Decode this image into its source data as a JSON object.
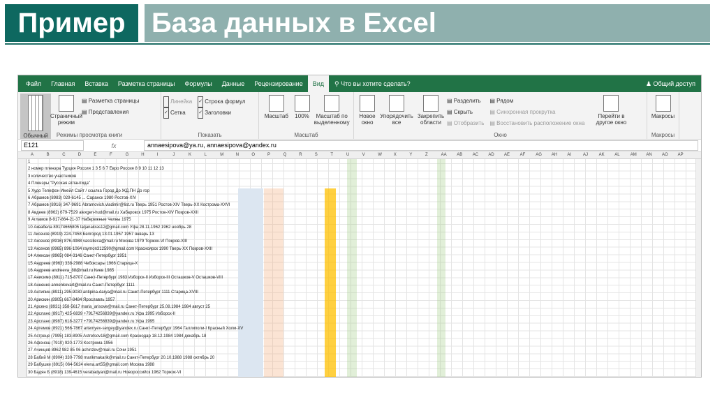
{
  "slide": {
    "tag": "Пример",
    "title": "База данных в Excel"
  },
  "excel": {
    "tabs": [
      "Файл",
      "Главная",
      "Вставка",
      "Разметка страницы",
      "Формулы",
      "Данные",
      "Рецензирование",
      "Вид"
    ],
    "active_tab": "Вид",
    "tell_me": "Что вы хотите сделать?",
    "share": "Общий доступ",
    "groups": {
      "views_label": "Режимы просмотра книги",
      "show_label": "Показать",
      "zoom_label": "Масштаб",
      "window_label": "Окно",
      "macros_label": "Макросы"
    },
    "buttons": {
      "normal": "Обычный",
      "page_break": "Страничный режим",
      "page_layout": "Разметка страницы",
      "custom_views": "Представления",
      "ruler": "Линейка",
      "formula_bar": "Строка формул",
      "gridlines": "Сетка",
      "headings": "Заголовки",
      "zoom": "Масштаб",
      "zoom100": "100%",
      "zoom_selection": "Масштаб по выделенному",
      "new_window": "Новое окно",
      "arrange_all": "Упорядочить все",
      "freeze": "Закрепить области",
      "split": "Разделить",
      "hide": "Скрыть",
      "unhide": "Отобразить",
      "side_by_side": "Рядом",
      "sync_scroll": "Синхронная прокрутка",
      "reset_pos": "Восстановить расположение окна",
      "switch": "Перейти в другое окно",
      "macros": "Макросы"
    },
    "name_box": "E121",
    "fx": "fx",
    "formula_value": "annaesipova@ya.ru, annaesipova@yandex.ru",
    "col_headers": [
      "A",
      "B",
      "C",
      "D",
      "E",
      "F",
      "G",
      "H",
      "I",
      "J",
      "K",
      "L",
      "M",
      "N",
      "O",
      "P",
      "Q",
      "R",
      "S",
      "T",
      "U",
      "V",
      "W",
      "X",
      "Y",
      "Z",
      "AA",
      "AB",
      "AC",
      "AD",
      "AE",
      "AF",
      "AG",
      "AH",
      "AI",
      "AJ",
      "AK",
      "AL",
      "AM",
      "AN",
      "AO",
      "AP"
    ],
    "rows": [
      "1",
      "2   номер пленэра                                   Турция  Россия       1  3  5  6  7    Евро Россия   8  9  10  11  12  13",
      "3   количество участников",
      "4   Пленэры \"Русская атлантида\"",
      "5   Худо  Телефон   Имейл   Сайт / ссылка   Город   До ЖД.ПН   До гор",
      "6   Абрамов  (8983) 029-6145  ...  Саранск   1980   Ростов-XIV",
      "7   Абрамов  (8916) 347-9691  Abramovich.vladimir@list.ru  Тверь   1951   Ростов-XIV  Тверь-XX  Кострома-XXVI",
      "8   Авдеев  (8962) 679-7529  alexgen-hud@mail.ru  Хабаровск   1975   Ростов-XIV  Покров-XXII",
      "9   Агламов  8-917-864-21-37  Набережные Челны   1975",
      "10  Аквабела  89174665805  tatjanakras12@gmail.com  Уфа  28.11.1962  1962  ноябрь  28",
      "11  Аксенов  (8919) 224-7458  Белгород  13.01.1957  1957  январь  13",
      "12  Аксенов  (8916) 876-4988  vassilieca@mail.ru  Москва   1979   Торжок-VI  Покров-XIII",
      "13  Аксенов  (8965) 896-1064  raymon312590@gmail.com  Красноярск   1990   Тверь-XX  Покров-XXII",
      "14  Алексан  (8965) 084-3146  Санкт-Петербург   1951",
      "15  Андреев  (8963) 338-2988  Чебоксары   1966   Старица-X",
      "16  Андреев  andreeva_88@mail.ru  Киев   1985",
      "17  Анисимо  (8911) 715-8707  Санкт-Петербург   1983   Изборск-II  Изборск-III  Осташков-V  Осташков-VIII",
      "18  Анненко  annenkovart@mail.ru  Санкт-Петербург  1111",
      "19  Антипин  (8911) 295-9030  antipina-darya@mail.ru  Санкт-Петербург  1111   Старица-XVIII",
      "20  Арискин  (8905) 667-8484  Ярославль   1957",
      "21  Арсено  (8931) 358-5617  maria_arisove@mail.ru  Санкт-Петербург  25.08.1984  1984  август  25",
      "22  Арслано  (8917) 425-6839  +79174256839@yandex.ru  Уфа   1995   Изборск-II",
      "23  Арслано  (8987) 618-3277  +79174256839@yandex.ru  Уфа   1995",
      "24  Артемов  (8921) 566-7867  artemyev-sergey@yandex.ru  Санкт-Петербург   1964   Галлиполи-I  Красный Холм-XV",
      "25  Астреце  (7995) 183-8905  Astretsov18@gmail.com  Краснодар  18.12.1984  1984  декабрь  18",
      "26  Афонош  (7910) 920-1773  Кострома   1956",
      "27  Ачинцев  8962 982 85 06  achinzev@mail.ru  Сочи   1951",
      "28  Бабий М  (8904) 330-7798  marikmakarik@mail.ru  Санкт-Петербург  20.10.1988  1988  октябрь  20",
      "29  Бабушки  (8915) 064-5624  elena.art55@gmail.com  Москва   1988",
      "30  Бадян Б  (8918) 139-4615  verabadyan@mail.ru  Новороссийск   1962   Торжок-VI"
    ]
  }
}
